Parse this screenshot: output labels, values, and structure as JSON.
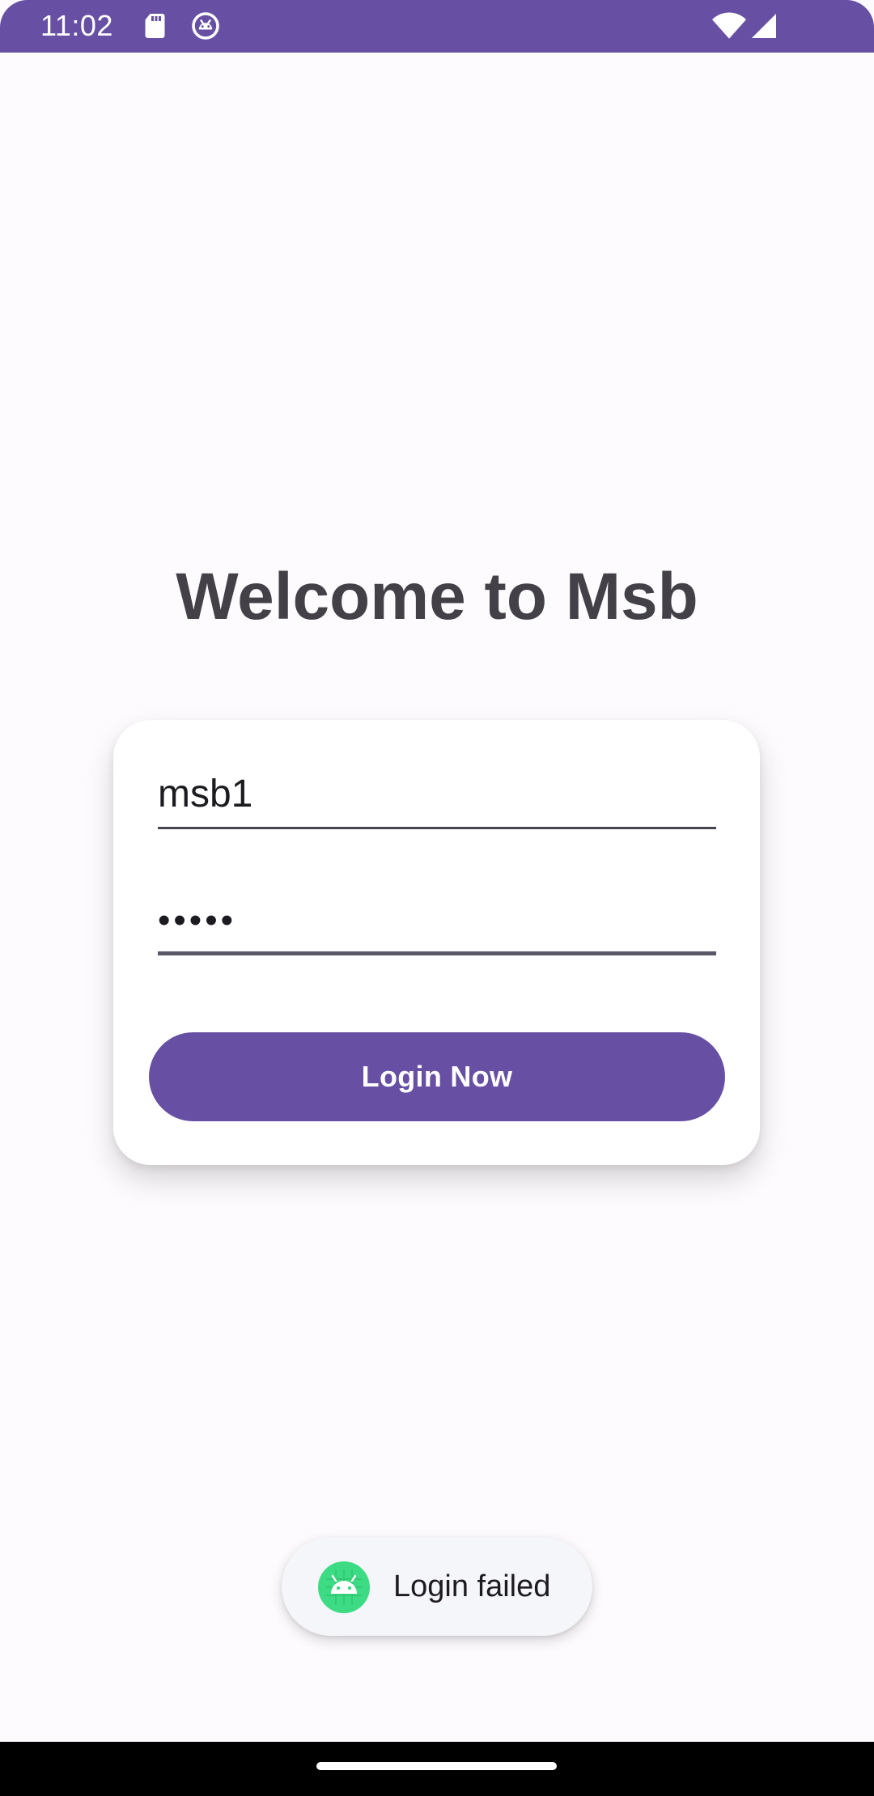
{
  "status_bar": {
    "time": "11:02",
    "icons": [
      "sd-card-icon",
      "android-debug-icon",
      "wifi-icon",
      "cell-signal-icon"
    ],
    "background": "#6750a4"
  },
  "title": "Welcome to Msb",
  "login_form": {
    "username_value": "msb1",
    "password_value": "•••••",
    "login_button_label": "Login Now",
    "accent_color": "#6750a4"
  },
  "toast": {
    "icon": "android-icon",
    "message": "Login failed"
  },
  "nav_bar": {
    "home_indicator": "home-handle"
  }
}
